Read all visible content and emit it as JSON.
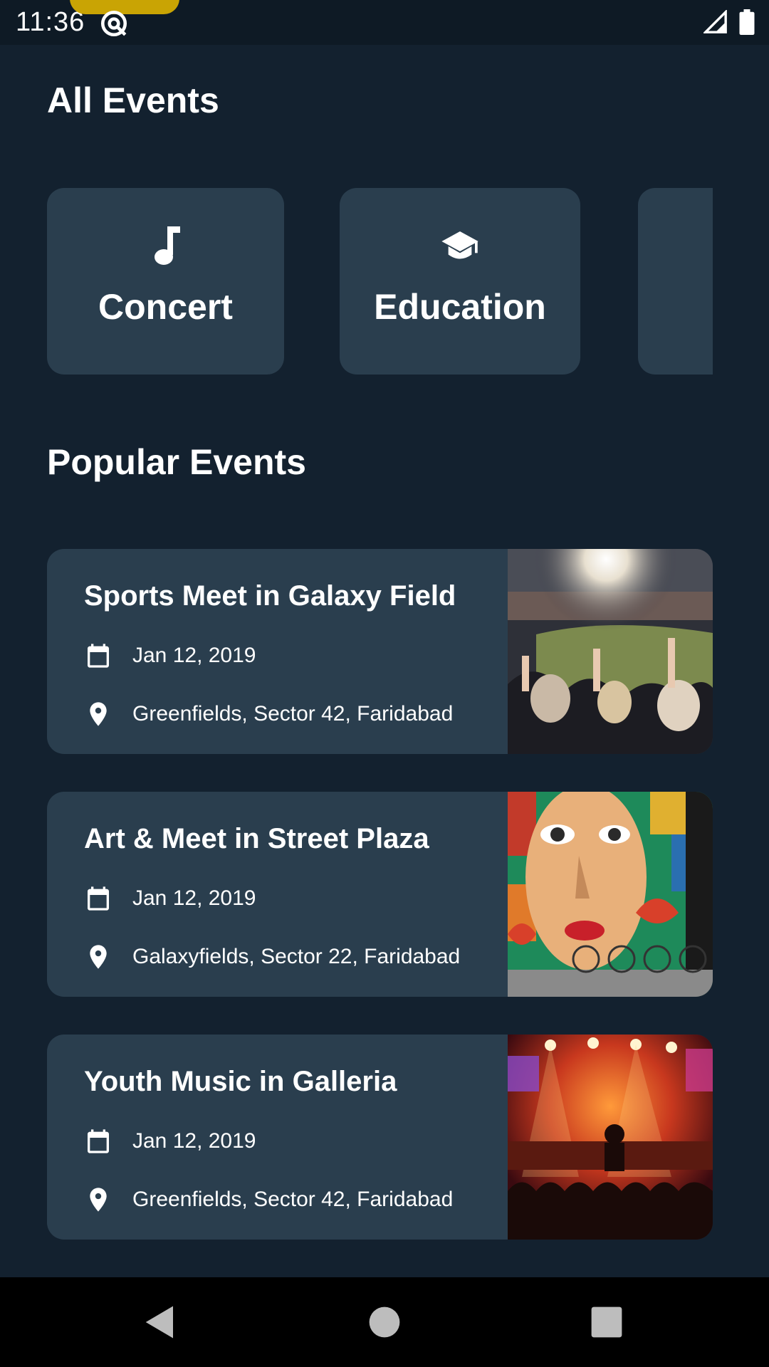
{
  "status_bar": {
    "time": "11:36",
    "icons": [
      "at-sign-icon",
      "cellular-signal-icon",
      "battery-icon"
    ]
  },
  "page_title": "All Events",
  "categories": [
    {
      "label": "Concert",
      "icon": "music-note-icon"
    },
    {
      "label": "Education",
      "icon": "graduation-cap-icon"
    },
    {
      "label": "",
      "icon": ""
    }
  ],
  "popular_title": "Popular Events",
  "events": [
    {
      "title": "Sports Meet in Galaxy Field",
      "date": "Jan 12, 2019",
      "location": "Greenfields, Sector 42, Faridabad",
      "image": "stadium-crowd-photo"
    },
    {
      "title": "Art & Meet in Street Plaza",
      "date": "Jan 12, 2019",
      "location": "Galaxyfields, Sector 22, Faridabad",
      "image": "street-art-mural-photo"
    },
    {
      "title": "Youth Music in Galleria",
      "date": "Jan 12, 2019",
      "location": "Greenfields, Sector 42, Faridabad",
      "image": "concert-stage-photo"
    }
  ],
  "nav_bar": {
    "icons": [
      "back-icon",
      "home-icon",
      "recents-icon"
    ]
  },
  "colors": {
    "background": "#13212F",
    "card": "#2A3E4E",
    "status_bar": "#0E1A25",
    "notch_accent": "#C9A404",
    "text": "#FFFFFF"
  }
}
